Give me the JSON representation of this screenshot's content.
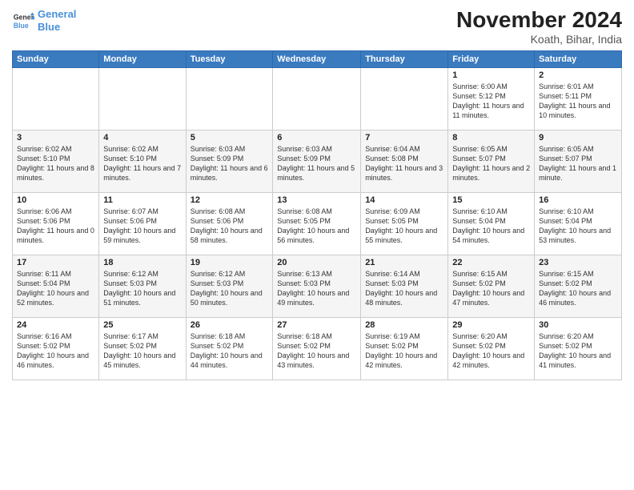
{
  "header": {
    "logo_line1": "General",
    "logo_line2": "Blue",
    "month": "November 2024",
    "location": "Koath, Bihar, India"
  },
  "weekdays": [
    "Sunday",
    "Monday",
    "Tuesday",
    "Wednesday",
    "Thursday",
    "Friday",
    "Saturday"
  ],
  "weeks": [
    [
      {
        "day": "",
        "info": ""
      },
      {
        "day": "",
        "info": ""
      },
      {
        "day": "",
        "info": ""
      },
      {
        "day": "",
        "info": ""
      },
      {
        "day": "",
        "info": ""
      },
      {
        "day": "1",
        "info": "Sunrise: 6:00 AM\nSunset: 5:12 PM\nDaylight: 11 hours and 11 minutes."
      },
      {
        "day": "2",
        "info": "Sunrise: 6:01 AM\nSunset: 5:11 PM\nDaylight: 11 hours and 10 minutes."
      }
    ],
    [
      {
        "day": "3",
        "info": "Sunrise: 6:02 AM\nSunset: 5:10 PM\nDaylight: 11 hours and 8 minutes."
      },
      {
        "day": "4",
        "info": "Sunrise: 6:02 AM\nSunset: 5:10 PM\nDaylight: 11 hours and 7 minutes."
      },
      {
        "day": "5",
        "info": "Sunrise: 6:03 AM\nSunset: 5:09 PM\nDaylight: 11 hours and 6 minutes."
      },
      {
        "day": "6",
        "info": "Sunrise: 6:03 AM\nSunset: 5:09 PM\nDaylight: 11 hours and 5 minutes."
      },
      {
        "day": "7",
        "info": "Sunrise: 6:04 AM\nSunset: 5:08 PM\nDaylight: 11 hours and 3 minutes."
      },
      {
        "day": "8",
        "info": "Sunrise: 6:05 AM\nSunset: 5:07 PM\nDaylight: 11 hours and 2 minutes."
      },
      {
        "day": "9",
        "info": "Sunrise: 6:05 AM\nSunset: 5:07 PM\nDaylight: 11 hours and 1 minute."
      }
    ],
    [
      {
        "day": "10",
        "info": "Sunrise: 6:06 AM\nSunset: 5:06 PM\nDaylight: 11 hours and 0 minutes."
      },
      {
        "day": "11",
        "info": "Sunrise: 6:07 AM\nSunset: 5:06 PM\nDaylight: 10 hours and 59 minutes."
      },
      {
        "day": "12",
        "info": "Sunrise: 6:08 AM\nSunset: 5:06 PM\nDaylight: 10 hours and 58 minutes."
      },
      {
        "day": "13",
        "info": "Sunrise: 6:08 AM\nSunset: 5:05 PM\nDaylight: 10 hours and 56 minutes."
      },
      {
        "day": "14",
        "info": "Sunrise: 6:09 AM\nSunset: 5:05 PM\nDaylight: 10 hours and 55 minutes."
      },
      {
        "day": "15",
        "info": "Sunrise: 6:10 AM\nSunset: 5:04 PM\nDaylight: 10 hours and 54 minutes."
      },
      {
        "day": "16",
        "info": "Sunrise: 6:10 AM\nSunset: 5:04 PM\nDaylight: 10 hours and 53 minutes."
      }
    ],
    [
      {
        "day": "17",
        "info": "Sunrise: 6:11 AM\nSunset: 5:04 PM\nDaylight: 10 hours and 52 minutes."
      },
      {
        "day": "18",
        "info": "Sunrise: 6:12 AM\nSunset: 5:03 PM\nDaylight: 10 hours and 51 minutes."
      },
      {
        "day": "19",
        "info": "Sunrise: 6:12 AM\nSunset: 5:03 PM\nDaylight: 10 hours and 50 minutes."
      },
      {
        "day": "20",
        "info": "Sunrise: 6:13 AM\nSunset: 5:03 PM\nDaylight: 10 hours and 49 minutes."
      },
      {
        "day": "21",
        "info": "Sunrise: 6:14 AM\nSunset: 5:03 PM\nDaylight: 10 hours and 48 minutes."
      },
      {
        "day": "22",
        "info": "Sunrise: 6:15 AM\nSunset: 5:02 PM\nDaylight: 10 hours and 47 minutes."
      },
      {
        "day": "23",
        "info": "Sunrise: 6:15 AM\nSunset: 5:02 PM\nDaylight: 10 hours and 46 minutes."
      }
    ],
    [
      {
        "day": "24",
        "info": "Sunrise: 6:16 AM\nSunset: 5:02 PM\nDaylight: 10 hours and 46 minutes."
      },
      {
        "day": "25",
        "info": "Sunrise: 6:17 AM\nSunset: 5:02 PM\nDaylight: 10 hours and 45 minutes."
      },
      {
        "day": "26",
        "info": "Sunrise: 6:18 AM\nSunset: 5:02 PM\nDaylight: 10 hours and 44 minutes."
      },
      {
        "day": "27",
        "info": "Sunrise: 6:18 AM\nSunset: 5:02 PM\nDaylight: 10 hours and 43 minutes."
      },
      {
        "day": "28",
        "info": "Sunrise: 6:19 AM\nSunset: 5:02 PM\nDaylight: 10 hours and 42 minutes."
      },
      {
        "day": "29",
        "info": "Sunrise: 6:20 AM\nSunset: 5:02 PM\nDaylight: 10 hours and 42 minutes."
      },
      {
        "day": "30",
        "info": "Sunrise: 6:20 AM\nSunset: 5:02 PM\nDaylight: 10 hours and 41 minutes."
      }
    ]
  ]
}
